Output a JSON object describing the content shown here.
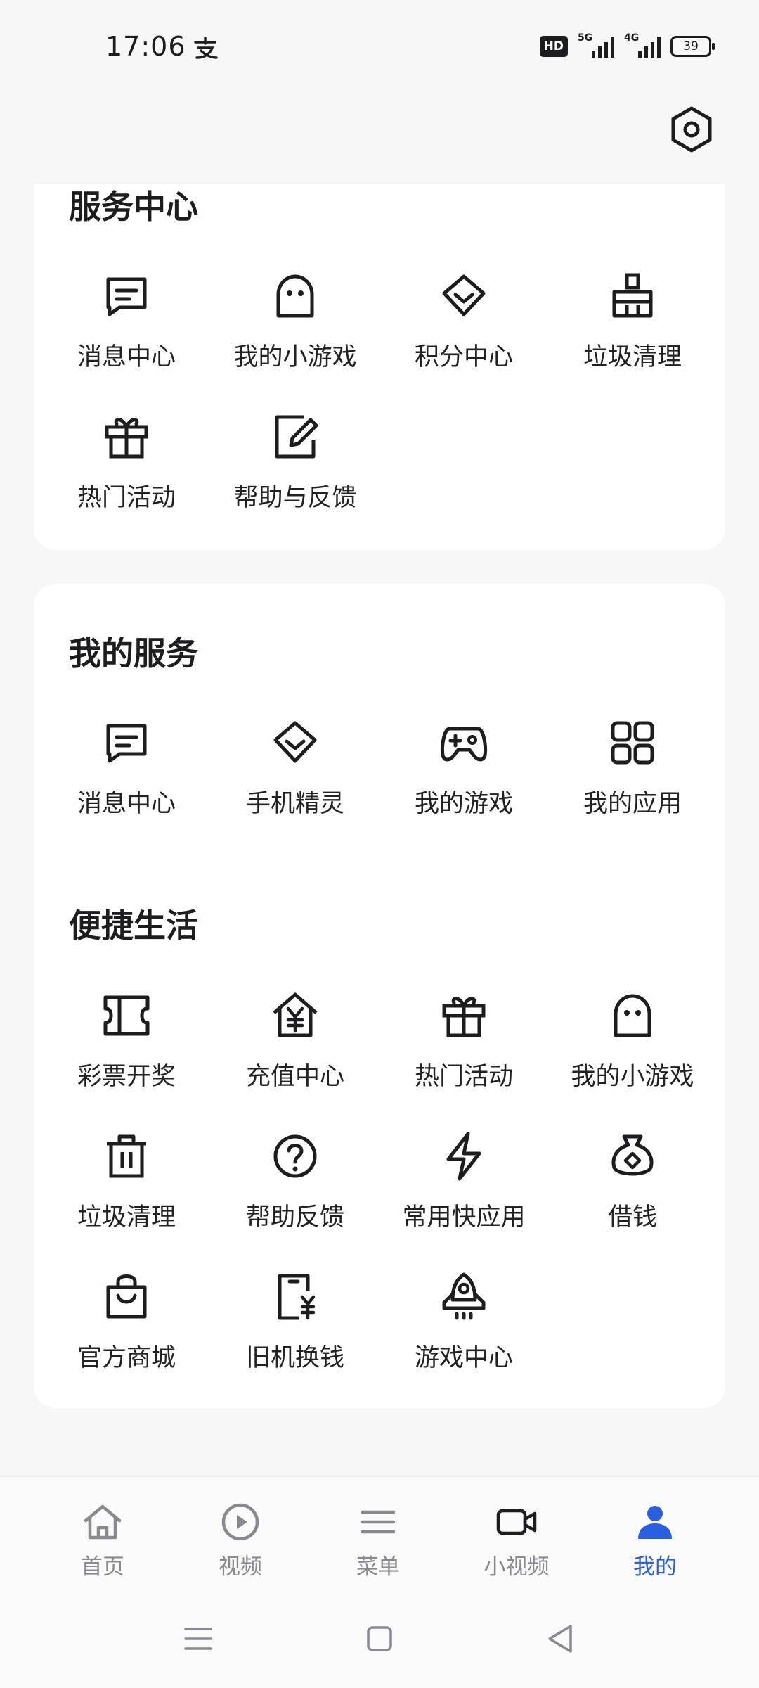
{
  "status_bar": {
    "time": "17:06",
    "hd_badge": "HD",
    "network_1": "5G",
    "network_2": "4G",
    "battery": "39"
  },
  "colors": {
    "accent": "#2a5fe0",
    "text": "#1d1d1f",
    "inactive": "#8a8a8e"
  },
  "service_center": {
    "title": "服务中心",
    "items": [
      {
        "label": "消息中心",
        "icon": "message-icon"
      },
      {
        "label": "我的小游戏",
        "icon": "ghost-icon"
      },
      {
        "label": "积分中心",
        "icon": "diamond-icon"
      },
      {
        "label": "垃圾清理",
        "icon": "broom-icon"
      },
      {
        "label": "热门活动",
        "icon": "gift-icon"
      },
      {
        "label": "帮助与反馈",
        "icon": "edit-icon"
      }
    ]
  },
  "my_services": {
    "title": "我的服务",
    "items": [
      {
        "label": "消息中心",
        "icon": "message-icon"
      },
      {
        "label": "手机精灵",
        "icon": "diamond-icon"
      },
      {
        "label": "我的游戏",
        "icon": "gamepad-icon"
      },
      {
        "label": "我的应用",
        "icon": "apps-grid-icon"
      }
    ]
  },
  "convenient_life": {
    "title": "便捷生活",
    "items": [
      {
        "label": "彩票开奖",
        "icon": "ticket-icon"
      },
      {
        "label": "充值中心",
        "icon": "house-yen-icon"
      },
      {
        "label": "热门活动",
        "icon": "gift-icon"
      },
      {
        "label": "我的小游戏",
        "icon": "ghost-icon"
      },
      {
        "label": "垃圾清理",
        "icon": "trash-icon"
      },
      {
        "label": "帮助反馈",
        "icon": "question-icon"
      },
      {
        "label": "常用快应用",
        "icon": "lightning-icon"
      },
      {
        "label": "借钱",
        "icon": "money-bag-icon"
      },
      {
        "label": "官方商城",
        "icon": "shopping-bag-icon"
      },
      {
        "label": "旧机换钱",
        "icon": "phone-yen-icon"
      },
      {
        "label": "游戏中心",
        "icon": "rocket-icon"
      }
    ]
  },
  "bottom_nav": {
    "tabs": [
      {
        "label": "首页",
        "icon": "home-icon",
        "active": false
      },
      {
        "label": "视频",
        "icon": "play-icon",
        "active": false
      },
      {
        "label": "菜单",
        "icon": "menu-icon",
        "active": false
      },
      {
        "label": "小视频",
        "icon": "camera-icon",
        "active": false
      },
      {
        "label": "我的",
        "icon": "person-icon",
        "active": true
      }
    ]
  }
}
